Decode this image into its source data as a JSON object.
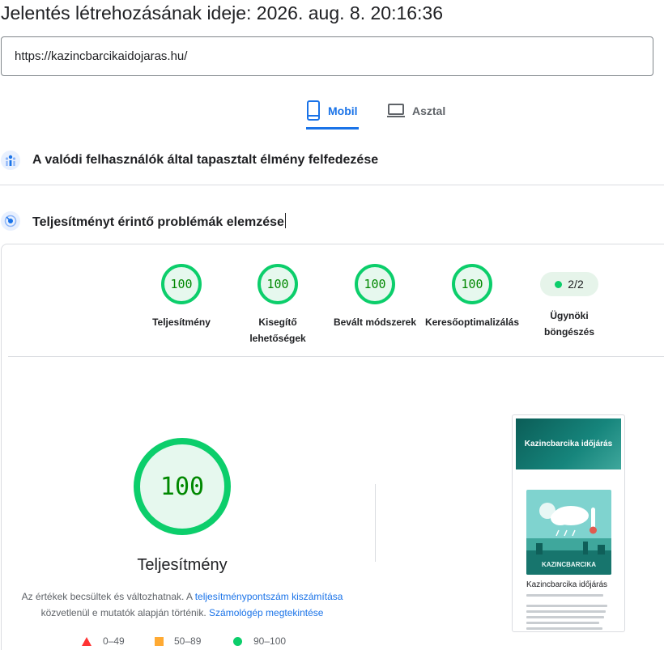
{
  "report": {
    "generated_label": "Jelentés létrehozásának ideje: 2026. aug. 8. 20:16:36"
  },
  "url_input": {
    "value": "https://kazincbarcikaidojaras.hu/"
  },
  "tabs": [
    {
      "label": "Mobil",
      "selected": true,
      "icon": "smartphone-icon"
    },
    {
      "label": "Asztal",
      "selected": false,
      "icon": "laptop-icon"
    }
  ],
  "sections": {
    "field_data_title": "A valódi felhasználók által tapasztalt élmény felfedezése",
    "diagnose_title": "Teljesítményt érintő problémák elemzése"
  },
  "categories": [
    {
      "label": "Teljesítmény",
      "score": "100"
    },
    {
      "label": "Kisegítő lehetőségek",
      "score": "100"
    },
    {
      "label": "Bevált módszerek",
      "score": "100"
    },
    {
      "label": "Keresőoptimalizálás",
      "score": "100"
    },
    {
      "label": "Ügynöki böngészés",
      "score": "2/2"
    }
  ],
  "performance": {
    "score": "100",
    "title": "Teljesítmény",
    "desc_prefix": "Az értékek becsültek és változhatnak. A ",
    "desc_link_1": "teljesítménypontszám kiszámítása",
    "desc_middle": " közvetlenül e mutatók alapján történik. ",
    "desc_link_2": "Számológép megtekintése"
  },
  "legend": [
    {
      "range": "0–49",
      "shape": "triangle",
      "color": "#ff3333"
    },
    {
      "range": "50–89",
      "shape": "square",
      "color": "#ffaa33"
    },
    {
      "range": "90–100",
      "shape": "circle",
      "color": "#0cce6b"
    }
  ],
  "screenshot_preview": {
    "header_title": "Kazincbarcika időjárás",
    "hero_caption": "KAZINCBARCIKA",
    "article_title": "Kazincbarcika időjárás"
  },
  "colors": {
    "pass_green": "#0cce6b",
    "pass_text": "#008800",
    "accent_blue": "#1a73e8"
  }
}
